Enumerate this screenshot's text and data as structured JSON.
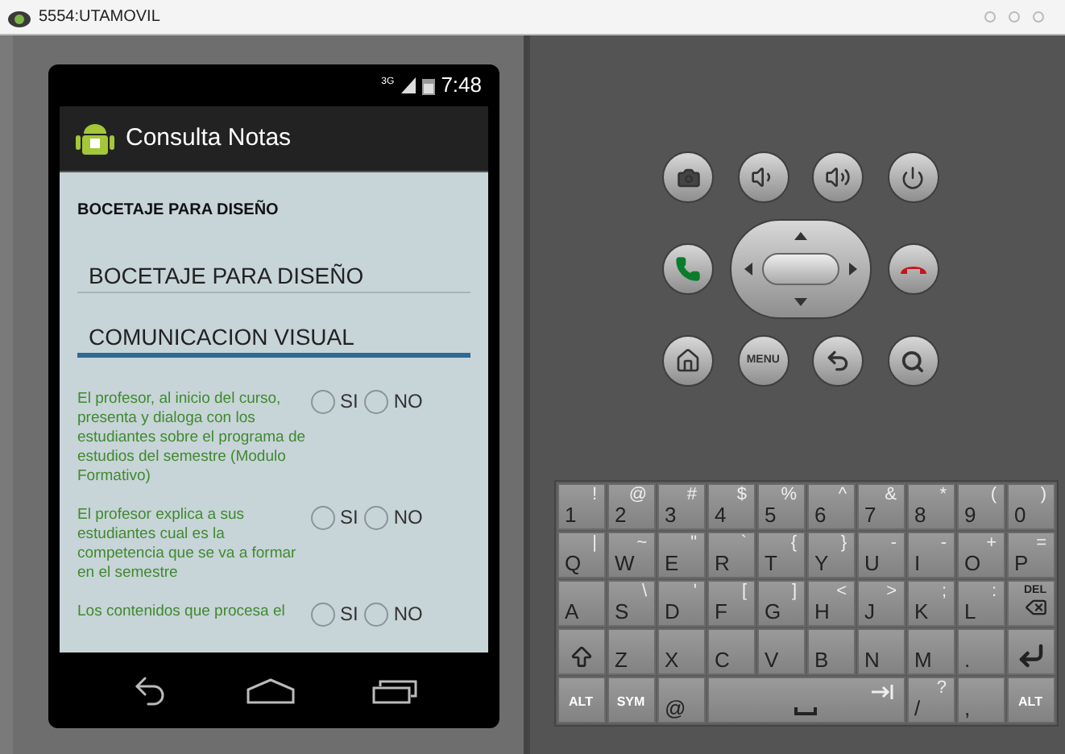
{
  "window": {
    "title": "5554:UTAMOVIL"
  },
  "status_bar": {
    "network": "3G",
    "time": "7:48"
  },
  "app": {
    "title": "Consulta Notas"
  },
  "heading": "BOCETAJE PARA DISEÑO",
  "subjects": [
    {
      "label": "BOCETAJE PARA DISEÑO",
      "selected": false
    },
    {
      "label": "COMUNICACION VISUAL",
      "selected": true
    }
  ],
  "questions": [
    {
      "text": "El profesor, al inicio del curso, presenta y dialoga con los estudiantes sobre el programa de estudios del semestre (Modulo Formativo)",
      "options": [
        {
          "label": "SI",
          "selected": false
        },
        {
          "label": "NO",
          "selected": false
        }
      ]
    },
    {
      "text": "El profesor explica a sus estudiantes cual es la competencia que se va a formar en el semestre",
      "options": [
        {
          "label": "SI",
          "selected": false
        },
        {
          "label": "NO",
          "selected": false
        }
      ]
    },
    {
      "text": "Los contenidos que procesa el",
      "options": [
        {
          "label": "SI",
          "selected": false
        },
        {
          "label": "NO",
          "selected": false
        }
      ]
    }
  ],
  "menu_key": "MENU",
  "keyboard": [
    [
      {
        "kind": "char",
        "label": "1",
        "alt": "!"
      },
      {
        "kind": "char",
        "label": "2",
        "alt": "@"
      },
      {
        "kind": "char",
        "label": "3",
        "alt": "#"
      },
      {
        "kind": "char",
        "label": "4",
        "alt": "$"
      },
      {
        "kind": "char",
        "label": "5",
        "alt": "%"
      },
      {
        "kind": "char",
        "label": "6",
        "alt": "^"
      },
      {
        "kind": "char",
        "label": "7",
        "alt": "&"
      },
      {
        "kind": "char",
        "label": "8",
        "alt": "*"
      },
      {
        "kind": "char",
        "label": "9",
        "alt": "("
      },
      {
        "kind": "char",
        "label": "0",
        "alt": ")"
      }
    ],
    [
      {
        "kind": "char",
        "label": "Q",
        "alt": "|"
      },
      {
        "kind": "char",
        "label": "W",
        "alt": "~"
      },
      {
        "kind": "char",
        "label": "E",
        "alt": "\""
      },
      {
        "kind": "char",
        "label": "R",
        "alt": "`"
      },
      {
        "kind": "char",
        "label": "T",
        "alt": "{"
      },
      {
        "kind": "char",
        "label": "Y",
        "alt": "}"
      },
      {
        "kind": "char",
        "label": "U",
        "alt": "-"
      },
      {
        "kind": "char",
        "label": "I",
        "alt": "-"
      },
      {
        "kind": "char",
        "label": "O",
        "alt": "+"
      },
      {
        "kind": "char",
        "label": "P",
        "alt": "="
      }
    ],
    [
      {
        "kind": "char",
        "label": "A"
      },
      {
        "kind": "char",
        "label": "S",
        "alt": "\\"
      },
      {
        "kind": "char",
        "label": "D",
        "alt": "'"
      },
      {
        "kind": "char",
        "label": "F",
        "alt": "["
      },
      {
        "kind": "char",
        "label": "G",
        "alt": "]"
      },
      {
        "kind": "char",
        "label": "H",
        "alt": "<"
      },
      {
        "kind": "char",
        "label": "J",
        "alt": ">"
      },
      {
        "kind": "char",
        "label": "K",
        "alt": ";"
      },
      {
        "kind": "char",
        "label": "L",
        "alt": ":"
      },
      {
        "kind": "delete",
        "label": "DEL"
      }
    ],
    [
      {
        "kind": "shift"
      },
      {
        "kind": "char",
        "label": "Z"
      },
      {
        "kind": "char",
        "label": "X"
      },
      {
        "kind": "char",
        "label": "C"
      },
      {
        "kind": "char",
        "label": "V"
      },
      {
        "kind": "char",
        "label": "B"
      },
      {
        "kind": "char",
        "label": "N"
      },
      {
        "kind": "char",
        "label": "M"
      },
      {
        "kind": "char",
        "label": "."
      },
      {
        "kind": "enter"
      }
    ],
    [
      {
        "kind": "small",
        "label": "ALT"
      },
      {
        "kind": "small",
        "label": "SYM"
      },
      {
        "kind": "char",
        "label": "@"
      },
      {
        "kind": "space"
      },
      {
        "kind": "char",
        "label": "/",
        "alt": "?"
      },
      {
        "kind": "char",
        "label": ","
      },
      {
        "kind": "small",
        "label": "ALT"
      }
    ]
  ]
}
